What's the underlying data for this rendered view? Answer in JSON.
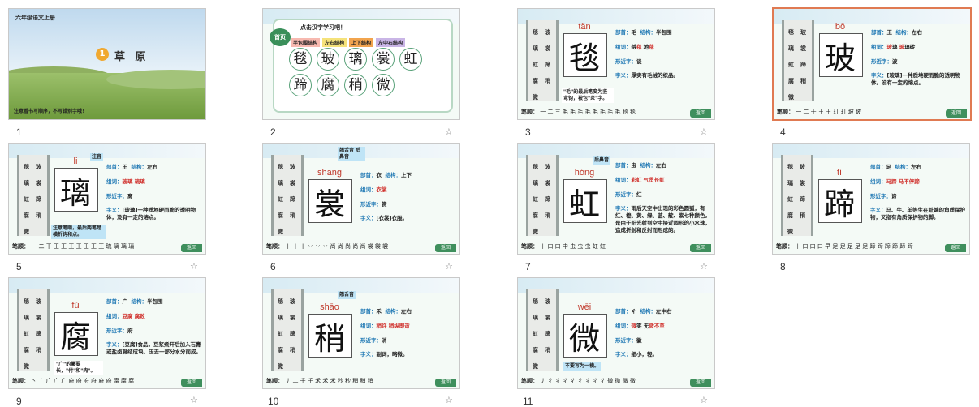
{
  "slides": [
    {
      "num": "1",
      "grade": "六年级语文上册",
      "circle": "1",
      "title": "草 原",
      "note": "注意看书写顺序，不写错别字哦！"
    },
    {
      "num": "2",
      "badge": "首页",
      "heading": "点击汉字学习吧！",
      "tags": [
        {
          "label": "半包围结构",
          "color": "#f7b9b0"
        },
        {
          "label": "左右结构",
          "color": "#f5e27a"
        },
        {
          "label": "上下结构",
          "color": "#f2a44e"
        },
        {
          "label": "左中右结构",
          "color": "#c9b5e6"
        }
      ],
      "chars": [
        "毯",
        "玻",
        "璃",
        "裳",
        "虹",
        "蹄",
        "腐",
        "稍",
        "微"
      ]
    },
    {
      "num": "3",
      "pinyin": "tǎn",
      "char": "毯",
      "bushou": "毛",
      "jiegou": "半包围",
      "zuci_a": "绒",
      "zuci_b": "毯",
      "zuci_c": "地",
      "zuci_d": "毯",
      "xingjin": "谈",
      "ziyi": "厚实有毛绒的织品。",
      "strokes": "一 二 三 毛 毛 毛 毛 毛 毛 毛 毛 毯 毯",
      "note": "\"毛\"的最后笔变为竖弯钩，被包\"炎\"字。"
    },
    {
      "num": "4",
      "pinyin": "bō",
      "char": "玻",
      "bushou": "王",
      "jiegou": "左右",
      "zuci_a": "玻",
      "zuci_b": "璃",
      "zuci_c": "玻",
      "zuci_d": "璃砖",
      "xingjin": "波",
      "ziyi": "[玻璃]一种质地硬而脆的透明物体。没有一定的熔点。",
      "strokes": "一 二 干 王 王 玎 玎 玻 玻"
    },
    {
      "num": "5",
      "pinyin": "li",
      "char": "璃",
      "bushou": "王",
      "jiegou": "左右",
      "zuci_a": "玻璃",
      "zuci_b": "琉璃",
      "xingjin": "离",
      "ziyi": "[玻璃]一种质地硬而脆的透明物体，没有一定的熔点。",
      "strokes": "一 二 干 王 王 王 王 王 王 王 琉 璃 璃 璃",
      "note": "注意笔顺，最后两笔是横折钩和点。",
      "tip": "注音"
    },
    {
      "num": "6",
      "pinyin": "shang",
      "char": "裳",
      "bushou": "衣",
      "jiegou": "上下",
      "zuci_a": "衣裳",
      "xingjin": "赏",
      "ziyi": "[衣裳]衣服。",
      "strokes": "丨 丨 丨 丷 丷 丷 尚 尚 尚 尚 尚 裳 裳 裳",
      "tip": "翘舌音 后鼻音"
    },
    {
      "num": "7",
      "pinyin": "hóng",
      "char": "虹",
      "bushou": "虫",
      "jiegou": "左右",
      "zuci_a": "彩虹",
      "zuci_b": "气贯长虹",
      "xingjin": "红",
      "ziyi": "雨后天空中出现的彩色圆弧，有红、橙、黄、绿、蓝、靛、紫七种颜色。是由于阳光射到空中接近圆形的小水珠，造成折射和反射而形成的。",
      "strokes": "丨 口 口 中 虫 虫 虫 虹 虹",
      "tip": "后鼻音"
    },
    {
      "num": "8",
      "pinyin": "tí",
      "char": "蹄",
      "bushou": "足",
      "jiegou": "左右",
      "zuci_a": "马蹄",
      "zuci_b": "马不停蹄",
      "xingjin": "谛",
      "ziyi": "马、牛、羊等生在趾端的角质保护物，又指有角质保护物的脚。",
      "strokes": "丨 口 口 口 早 足 足 足 足 足 蹄 蹄 蹄 蹄 蹄 蹄"
    },
    {
      "num": "9",
      "pinyin": "fǔ",
      "char": "腐",
      "bushou": "广",
      "jiegou": "半包围",
      "zuci_a": "豆腐",
      "zuci_b": "腐败",
      "xingjin": "府",
      "ziyi": "[豆腐]食品，豆浆煮开后加入石膏或盐卤凝结成块，压去一部分水分而成。",
      "strokes": "丶 亠 广 广 广 府 府 府 府 府 府 腐 腐 腐",
      "note": "\"广\"的撇要长，\"付\"和\"肉\"。"
    },
    {
      "num": "10",
      "pinyin": "shāo",
      "char": "稍",
      "bushou": "禾",
      "jiegou": "左右",
      "zuci_a": "稍许",
      "zuci_b": "稍纵即逝",
      "xingjin": "消",
      "ziyi": "副词，略微。",
      "strokes": "丿 二 千 千 禾 禾 禾 秒 秒 稍 稍 稍",
      "tip": "翘舌音"
    },
    {
      "num": "11",
      "pinyin": "wēi",
      "char": "微",
      "bushou": "彳",
      "jiegou": "左中右",
      "zuci_a": "微",
      "zuci_b": "笑",
      "zuci_c": "无",
      "zuci_d": "微不至",
      "xingjin": "徽",
      "ziyi": "细小，轻。",
      "strokes": "丿 彳 彳 彳 彳 彳 彳 彳 彳 微 微 微 微",
      "note": "不要写为一横。"
    }
  ],
  "labels": {
    "bushou": "部首：",
    "jiegou": "结构：",
    "zuci": "组词：",
    "xingjin": "形近字：",
    "ziyi": "字义：",
    "bishun": "笔顺：",
    "back": "返回"
  },
  "sidebar_chars": [
    "毯",
    "玻",
    "璃",
    "裳",
    "虹",
    "蹄",
    "腐",
    "稍",
    "微"
  ]
}
